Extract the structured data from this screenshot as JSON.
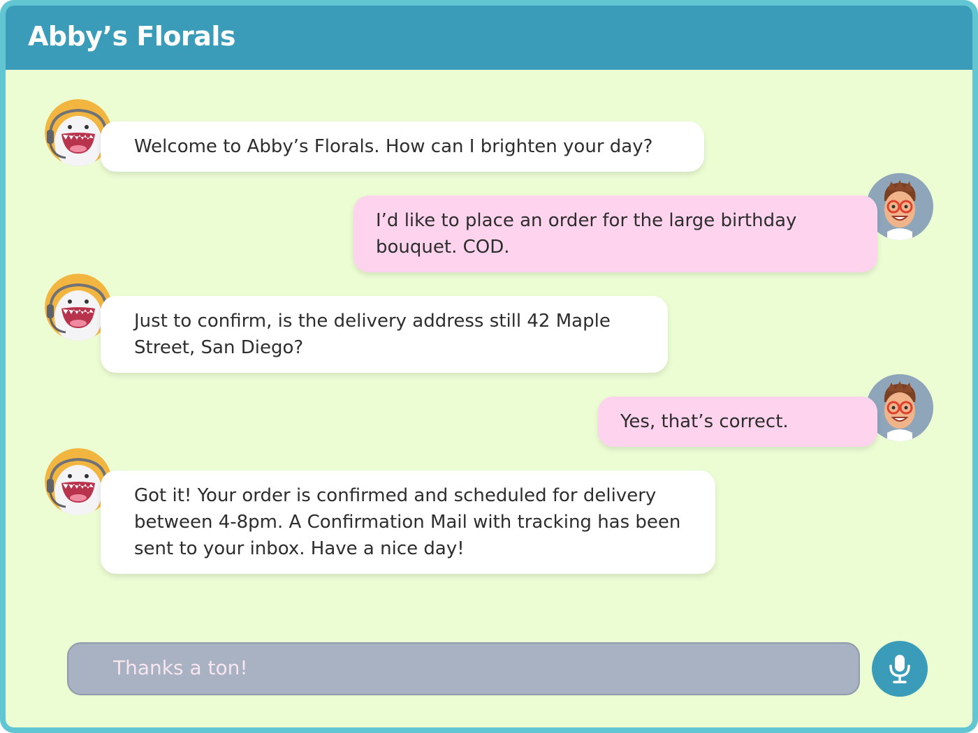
{
  "app": {
    "title": "Abby’s Florals"
  },
  "colors": {
    "header": "#3a9cb9",
    "frame_border": "#62c6d2",
    "chat_background": "#ecfcd3",
    "bot_bubble": "#ffffff",
    "user_bubble": "#fdd3ee",
    "input_bar": "#a8b2c2",
    "mic_button": "#3a9cb9"
  },
  "messages": [
    {
      "sender": "bot",
      "avatar_icon": "bot-avatar-icon",
      "text": "Welcome to Abby’s Florals. How can I brighten your day?"
    },
    {
      "sender": "user",
      "avatar_icon": "user-avatar-icon",
      "text": "I’d like to place an order for the large birthday bouquet. COD."
    },
    {
      "sender": "bot",
      "avatar_icon": "bot-avatar-icon",
      "text": "Just to confirm, is the delivery address still 42 Maple Street, San Diego?"
    },
    {
      "sender": "user",
      "avatar_icon": "user-avatar-icon",
      "text": "Yes, that’s correct."
    },
    {
      "sender": "bot",
      "avatar_icon": "bot-avatar-icon",
      "text": "Got it! Your order is confirmed and scheduled for delivery between 4-8pm. A Confirmation Mail with tracking has been sent to your inbox. Have a nice day!"
    }
  ],
  "composer": {
    "value": "Thanks a ton!",
    "mic_icon": "microphone-icon"
  }
}
